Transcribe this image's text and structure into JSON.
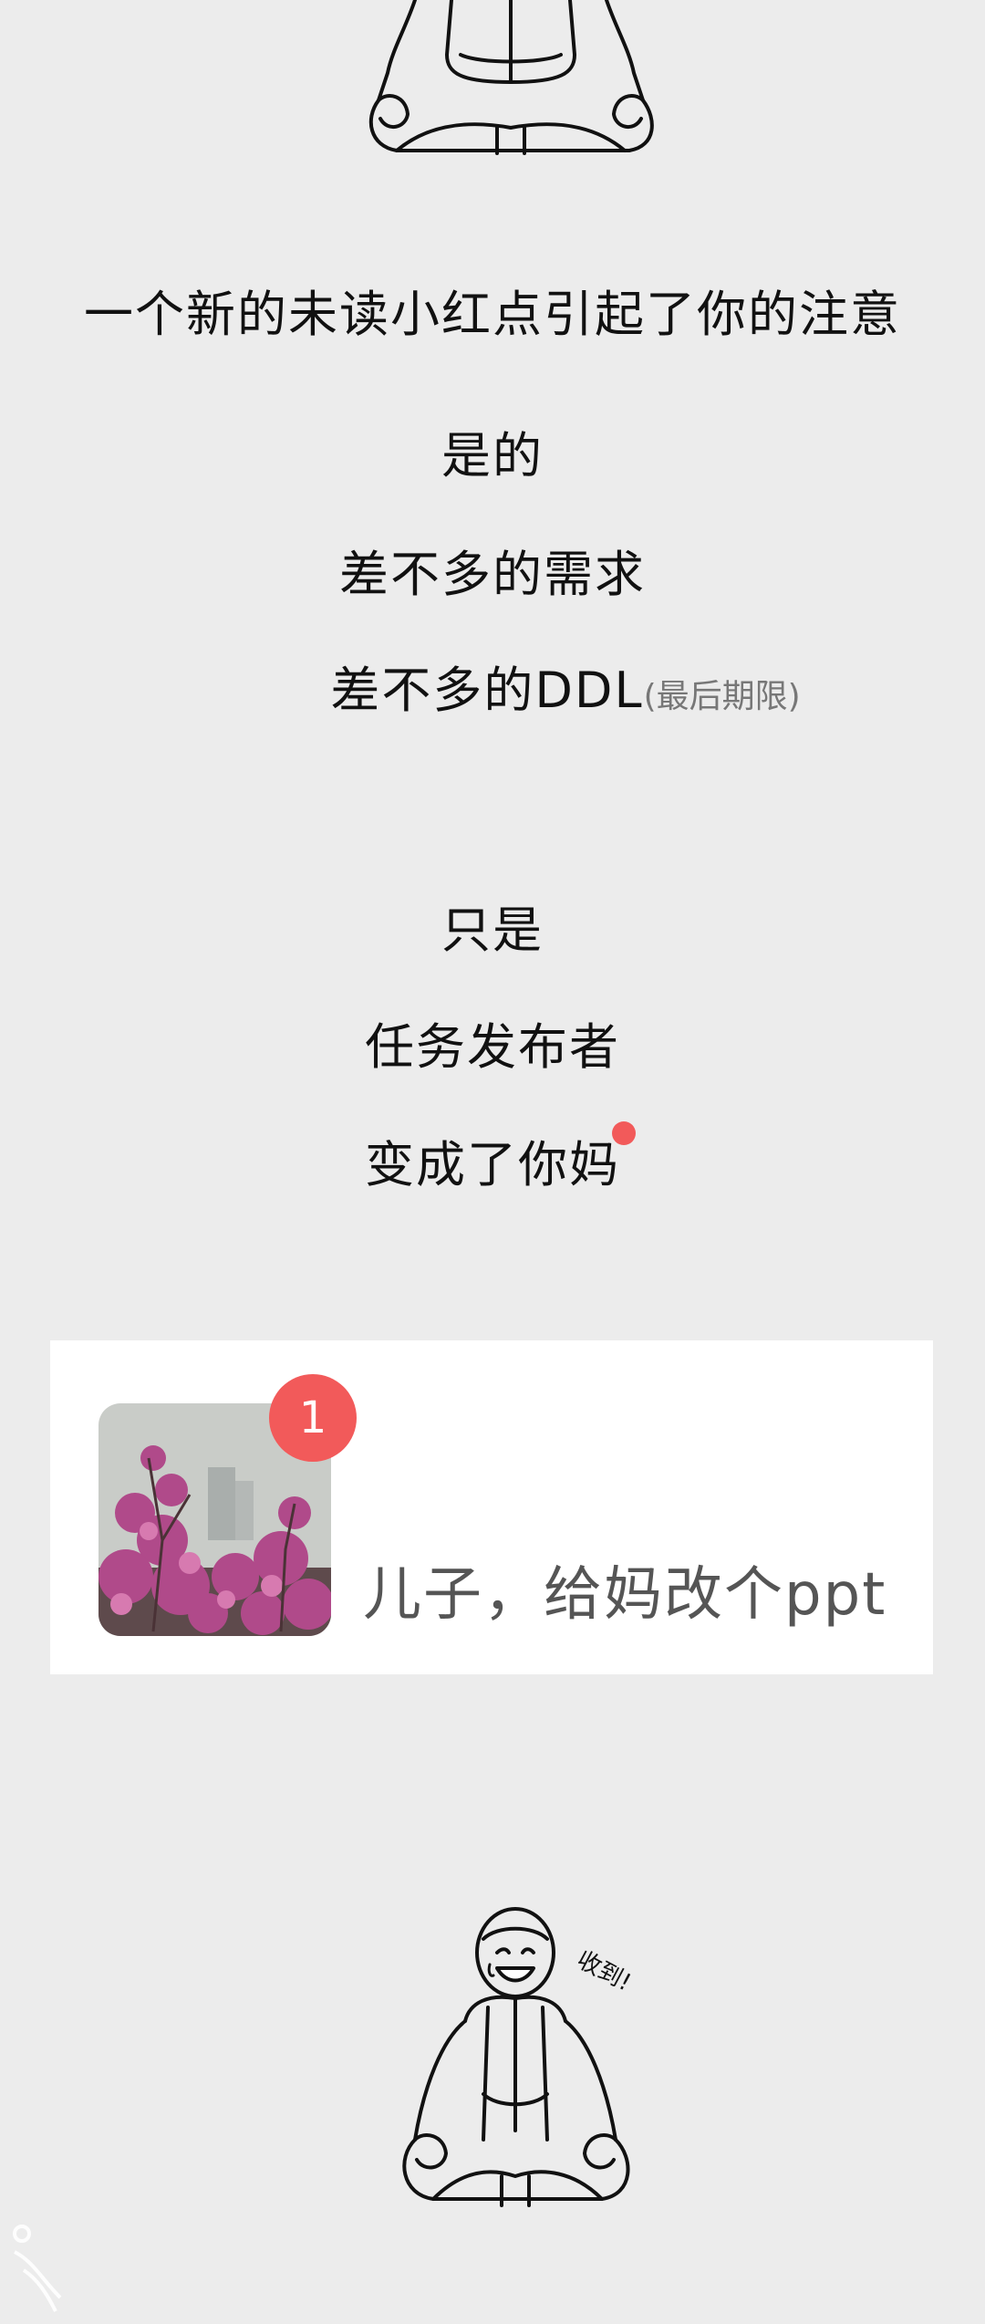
{
  "story": {
    "line1": "一个新的未读小红点引起了你的注意",
    "line2": "是的",
    "line3": "差不多的需求",
    "line4_main": "差不多的DDL",
    "line4_aside": "(最后期限)",
    "line5": "只是",
    "line6": "任务发布者",
    "line7": "变成了你妈"
  },
  "notification": {
    "badge_count": "1",
    "message": "儿子，给妈改个ppt"
  },
  "illustration": {
    "speech": "收到!"
  },
  "colors": {
    "background": "#ececec",
    "badge_red": "#f25a5a",
    "card_bg": "#ffffff"
  }
}
